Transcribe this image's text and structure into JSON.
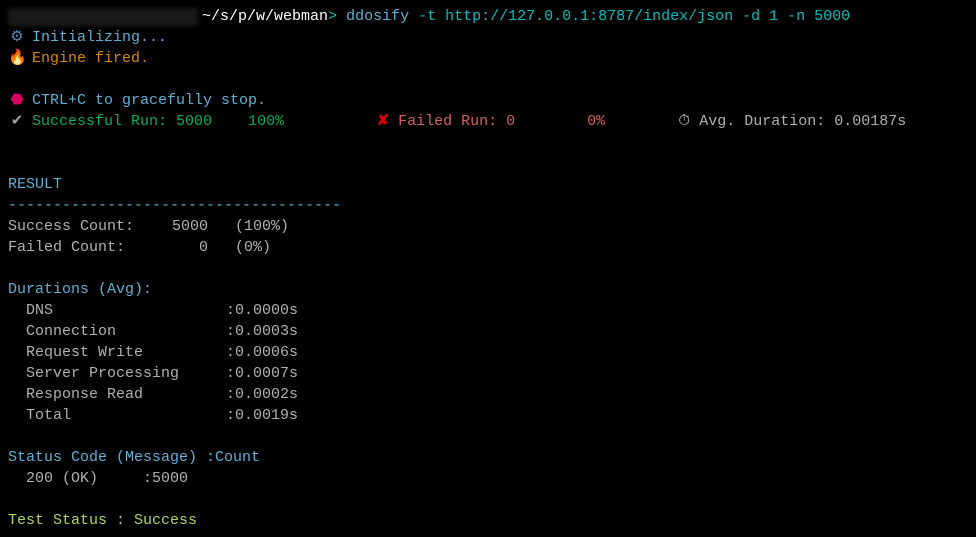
{
  "prompt": {
    "path": "~/s/p/w/webman",
    "separator": ">",
    "command": "ddosify",
    "args": "-t http://127.0.0.1:8787/index/json -d 1 -n 5000"
  },
  "init": {
    "initializing": "Initializing...",
    "engine_fired": "Engine fired."
  },
  "ctrl_c": "CTRL+C to gracefully stop.",
  "stats": {
    "success_label": "Successful Run:",
    "success_count": "5000",
    "success_pct": "100%",
    "failed_label": "Failed Run:",
    "failed_count": "0",
    "failed_pct": "0%",
    "avg_label": "Avg. Duration:",
    "avg_value": "0.00187s"
  },
  "result": {
    "heading": "RESULT",
    "divider": "-------------------------------------",
    "success_count_label": "Success Count:",
    "success_count_value": "5000",
    "success_count_pct": "(100%)",
    "failed_count_label": "Failed Count:",
    "failed_count_value": "0",
    "failed_count_pct": "(0%)"
  },
  "durations": {
    "heading": "Durations (Avg):",
    "rows": [
      {
        "label": "DNS",
        "value": ":0.0000s"
      },
      {
        "label": "Connection",
        "value": ":0.0003s"
      },
      {
        "label": "Request Write",
        "value": ":0.0006s"
      },
      {
        "label": "Server Processing",
        "value": ":0.0007s"
      },
      {
        "label": "Response Read",
        "value": ":0.0002s"
      },
      {
        "label": "Total",
        "value": ":0.0019s"
      }
    ]
  },
  "status_code": {
    "heading": "Status Code (Message) :Count",
    "row": "200 (OK)     :5000"
  },
  "test_status": {
    "label": "Test Status :",
    "value": "Success"
  }
}
